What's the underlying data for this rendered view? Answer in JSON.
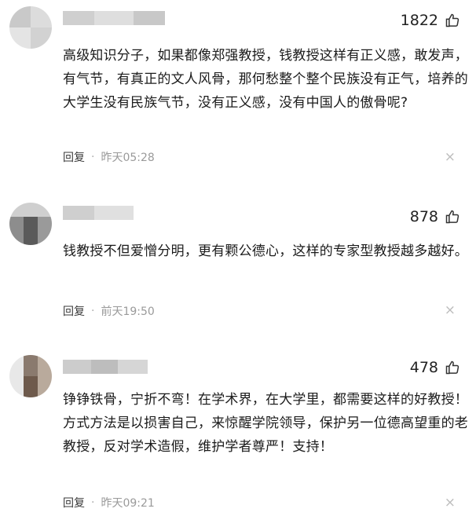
{
  "comments": [
    {
      "likes": "1822",
      "text": "高级知识分子，如果都像郑强教授，钱教授这样有正义感，敢发声，有气节，有真正的文人风骨，那何愁整个整个民族没有正气，培养的大学生没有民族气节，没有正义感，没有中国人的傲骨呢?",
      "reply_label": "回复",
      "separator": "·",
      "time": "昨天05:28",
      "close": "×"
    },
    {
      "likes": "878",
      "text": "钱教授不但爱憎分明，更有颗公德心，这样的专家型教授越多越好。",
      "reply_label": "回复",
      "separator": "·",
      "time": "前天19:50",
      "close": "×"
    },
    {
      "likes": "478",
      "text": "铮铮铁骨，宁折不弯！在学术界，在大学里，都需要这样的好教授！方式方法是以损害自己，来惊醒学院领导，保护另一位德高望重的老教授，反对学术造假，维护学者尊严！支持！",
      "reply_label": "回复",
      "separator": "·",
      "time": "昨天09:21",
      "close": "×"
    }
  ],
  "icons": {
    "like": "thumbs-up-icon",
    "close": "close-icon"
  }
}
